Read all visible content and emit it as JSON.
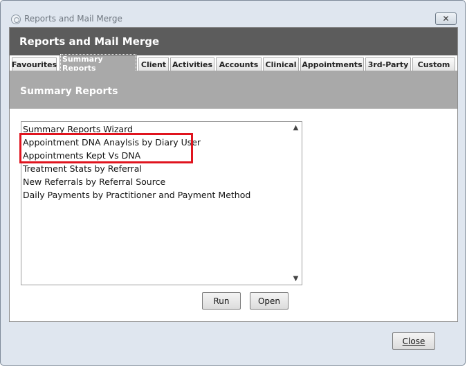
{
  "window": {
    "title": "Reports and Mail Merge",
    "close_glyph": "✕"
  },
  "header": {
    "title": "Reports and Mail Merge"
  },
  "tabs": [
    {
      "label": "Favourites",
      "active": false
    },
    {
      "label": "Summary Reports",
      "active": true
    },
    {
      "label": "Client",
      "active": false
    },
    {
      "label": "Activities",
      "active": false
    },
    {
      "label": "Accounts",
      "active": false
    },
    {
      "label": "Clinical",
      "active": false
    },
    {
      "label": "Appointments",
      "active": false
    },
    {
      "label": "3rd-Party",
      "active": false
    },
    {
      "label": "Custom",
      "active": false
    }
  ],
  "section": {
    "title": "Summary Reports"
  },
  "reports": {
    "items": [
      "Summary Reports Wizard",
      "Appointment DNA Anaylsis by Diary User",
      "Appointments Kept Vs DNA",
      "Treatment Stats by Referral",
      "New Referrals by Referral Source",
      "Daily Payments by Practitioner and Payment Method"
    ],
    "scroll_up_glyph": "▲",
    "scroll_down_glyph": "▼"
  },
  "actions": {
    "run_label": "Run",
    "open_label": "Open"
  },
  "footer": {
    "close_label": "Close"
  },
  "colors": {
    "header": "#5c5c5c",
    "section": "#a9a9a9",
    "highlight": "#e0141e"
  }
}
